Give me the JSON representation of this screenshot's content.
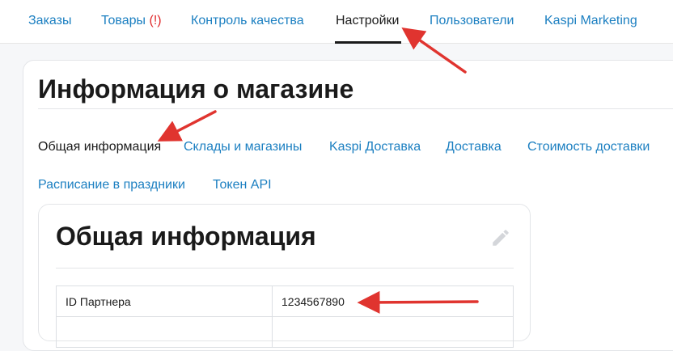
{
  "topnav": {
    "tabs": [
      {
        "label": "Заказы"
      },
      {
        "label": "Товары",
        "badge": "(!)"
      },
      {
        "label": "Контроль качества"
      },
      {
        "label": "Настройки"
      },
      {
        "label": "Пользователи"
      },
      {
        "label": "Kaspi Marketing"
      }
    ]
  },
  "page": {
    "title": "Информация о магазине",
    "subtabs": [
      {
        "label": "Общая информация"
      },
      {
        "label": "Склады и магазины"
      },
      {
        "label": "Kaspi Доставка"
      },
      {
        "label": "Доставка"
      },
      {
        "label": "Стоимость доставки"
      },
      {
        "label": "Расписание в праздники"
      },
      {
        "label": "Токен API"
      }
    ]
  },
  "general_info": {
    "title": "Общая информация",
    "rows": [
      {
        "key": "ID Партнера",
        "value": "1234567890"
      },
      {
        "key": "",
        "value": ""
      }
    ]
  },
  "icons": {
    "edit": "pencil-icon"
  },
  "colors": {
    "link": "#1b7fc1",
    "warning": "#e0292b",
    "annotation_arrow": "#e0342f"
  }
}
